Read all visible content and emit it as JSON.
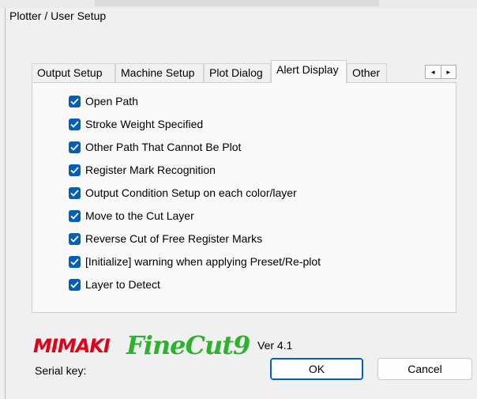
{
  "window": {
    "title": "Plotter / User Setup"
  },
  "tabs": [
    {
      "label": "Output Setup",
      "active": false
    },
    {
      "label": "Machine Setup",
      "active": false
    },
    {
      "label": "Plot Dialog",
      "active": false
    },
    {
      "label": "Alert Display",
      "active": true
    },
    {
      "label": "Other",
      "active": false
    }
  ],
  "tab_scroll": {
    "left": "◂",
    "right": "▸"
  },
  "alert_options": [
    {
      "label": "Open Path",
      "checked": true
    },
    {
      "label": "Stroke Weight Specified",
      "checked": true
    },
    {
      "label": "Other Path That Cannot Be Plot",
      "checked": true
    },
    {
      "label": "Register Mark Recognition",
      "checked": true
    },
    {
      "label": "Output Condition Setup on each color/layer",
      "checked": true
    },
    {
      "label": "Move to the Cut Layer",
      "checked": true
    },
    {
      "label": "Reverse Cut of Free Register Marks",
      "checked": true
    },
    {
      "label": "[Initialize] warning when applying Preset/Re-plot",
      "checked": true
    },
    {
      "label": "Layer to Detect",
      "checked": true
    }
  ],
  "footer": {
    "brand": "MIMAKI",
    "product": "FineCut9",
    "version": "Ver 4.1",
    "serial_label": "Serial key:",
    "ok_label": "OK",
    "cancel_label": "Cancel"
  },
  "colors": {
    "checkbox": "#005fb8",
    "brand_red": "#e0001a",
    "product_green": "#2db22d",
    "panel_bg": "#f9f9f9",
    "dialog_bg": "#f0f0f0"
  }
}
